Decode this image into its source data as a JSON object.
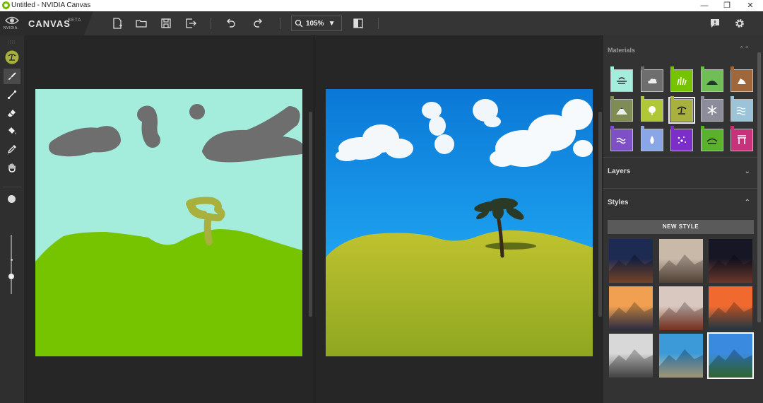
{
  "window": {
    "title": "Untitled - NVIDIA Canvas",
    "controls": [
      "—",
      "❐",
      "✕"
    ]
  },
  "brand": {
    "logo_text": "NVIDIA.",
    "name": "CANVAS",
    "badge": "BETA"
  },
  "toolbar": {
    "zoom_value": "105%",
    "buttons": [
      "new-file",
      "open-folder",
      "save",
      "export",
      "undo",
      "redo",
      "toggle-view"
    ]
  },
  "right_toolbar": {
    "buttons": [
      "feedback",
      "settings"
    ]
  },
  "tools": {
    "active": "brush",
    "items": [
      "material-picker",
      "brush",
      "line",
      "eraser",
      "fill",
      "eyedropper",
      "pan"
    ],
    "brush_size_level": 0.3
  },
  "materials": {
    "header": "Materials",
    "selected_index": 7,
    "items": [
      {
        "name": "sky",
        "color": "#a4ecdc"
      },
      {
        "name": "cloud",
        "color": "#6e6e6e"
      },
      {
        "name": "grass",
        "color": "#76c400"
      },
      {
        "name": "hill",
        "color": "#6fbf56"
      },
      {
        "name": "rock",
        "color": "#a0673a"
      },
      {
        "name": "mountain",
        "color": "#7f8c55"
      },
      {
        "name": "bush",
        "color": "#b0c837"
      },
      {
        "name": "tree",
        "color": "#a8b03e"
      },
      {
        "name": "snow",
        "color": "#8c8c9a"
      },
      {
        "name": "fog",
        "color": "#9cc3d8"
      },
      {
        "name": "water",
        "color": "#7d50c6"
      },
      {
        "name": "waterfall",
        "color": "#8aa6e6"
      },
      {
        "name": "stars",
        "color": "#7c2fc8"
      },
      {
        "name": "land",
        "color": "#5ab22c"
      },
      {
        "name": "structure",
        "color": "#c8327a"
      }
    ]
  },
  "sections": {
    "layers": {
      "label": "Layers",
      "chevron": "⌄"
    },
    "styles": {
      "label": "Styles",
      "chevron": "⌃"
    }
  },
  "styles": {
    "new_style_label": "NEW STYLE",
    "selected_index": 8,
    "thumbs": [
      {
        "name": "desert-night",
        "colors": [
          "#1d2a52",
          "#9b5a34"
        ]
      },
      {
        "name": "snowy-peaks",
        "colors": [
          "#c9b9a8",
          "#6f5a4a"
        ]
      },
      {
        "name": "rock-arch-stars",
        "colors": [
          "#161624",
          "#8d4a3a"
        ]
      },
      {
        "name": "sunset-mountains",
        "colors": [
          "#f0a050",
          "#3c3c5a"
        ]
      },
      {
        "name": "red-cliffs",
        "colors": [
          "#d8c8c0",
          "#a0402a"
        ]
      },
      {
        "name": "ocean-sunset",
        "colors": [
          "#f06a30",
          "#2a4a5a"
        ]
      },
      {
        "name": "misty-mountain",
        "colors": [
          "#d8d8d8",
          "#5a5a5a"
        ]
      },
      {
        "name": "beach-sky",
        "colors": [
          "#3c9ad8",
          "#d8c8a0"
        ]
      },
      {
        "name": "alpine-lake",
        "colors": [
          "#3a8ae0",
          "#3e8a3a"
        ]
      }
    ]
  },
  "colors": {
    "accent": "#76b900"
  }
}
